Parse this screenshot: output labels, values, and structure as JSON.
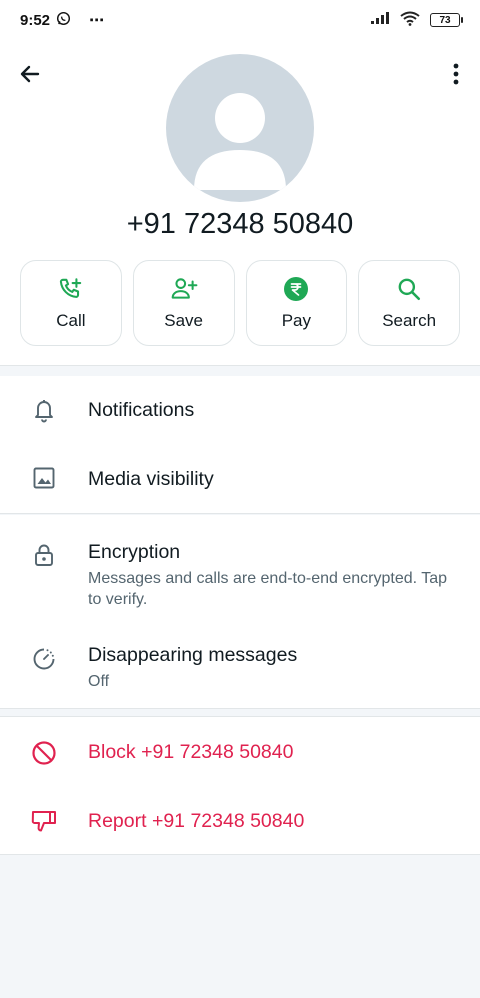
{
  "status": {
    "time": "9:52",
    "battery": "73"
  },
  "contact": {
    "phone": "+91 72348 50840"
  },
  "actions": [
    {
      "label": "Call"
    },
    {
      "label": "Save"
    },
    {
      "label": "Pay"
    },
    {
      "label": "Search"
    }
  ],
  "settings": {
    "notifications": "Notifications",
    "media_visibility": "Media visibility",
    "encryption": "Encryption",
    "encryption_sub": "Messages and calls are end-to-end encrypted. Tap to verify.",
    "disappearing": "Disappearing messages",
    "disappearing_sub": "Off",
    "block": "Block +91 72348 50840",
    "report": "Report +91 72348 50840"
  },
  "colors": {
    "accent": "#1fa855",
    "danger": "#e0224f",
    "icon": "#54656f"
  }
}
